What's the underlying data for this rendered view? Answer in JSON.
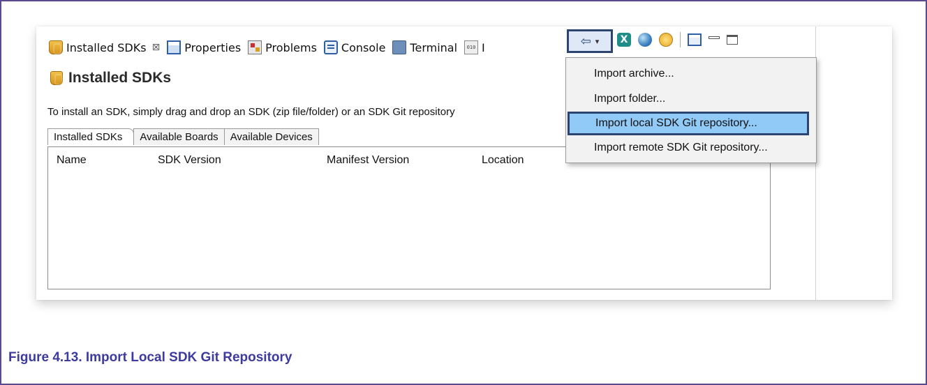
{
  "view_tabs": [
    {
      "label": "Installed SDKs",
      "icon": "sdk-icon",
      "close": "⊠"
    },
    {
      "label": "Properties",
      "icon": "properties-icon"
    },
    {
      "label": "Problems",
      "icon": "problems-icon"
    },
    {
      "label": "Console",
      "icon": "console-icon"
    },
    {
      "label": "Terminal",
      "icon": "terminal-icon"
    },
    {
      "label": "I",
      "icon": "binary-icon"
    }
  ],
  "toolbar": {
    "import_glyph": "⇦",
    "dropdown_glyph": "▾",
    "x_tool_glyph": "X"
  },
  "page": {
    "title": "Installed SDKs",
    "instruction": "To install an SDK, simply drag and drop an SDK (zip file/folder) or an SDK Git repository"
  },
  "subtabs": [
    "Installed SDKs",
    "Available Boards",
    "Available Devices"
  ],
  "table": {
    "columns": [
      "Name",
      "SDK Version",
      "Manifest Version",
      "Location"
    ]
  },
  "menu": {
    "items": [
      "Import archive...",
      "Import folder...",
      "Import local SDK Git repository...",
      "Import remote SDK Git repository..."
    ],
    "selected_index": 2
  },
  "caption": "Figure 4.13. Import Local SDK Git Repository",
  "colors": {
    "highlight_border": "#2b4470",
    "menu_selected": "#91c9f7",
    "caption": "#3d3aa0",
    "frame_border": "#5b4a8e"
  }
}
